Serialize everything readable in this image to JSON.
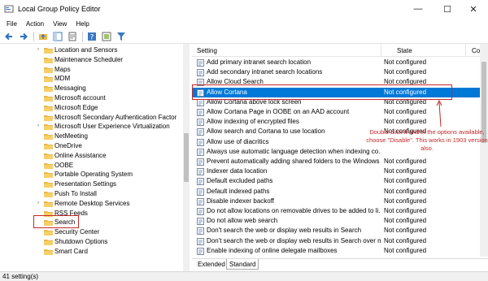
{
  "window": {
    "title": "Local Group Policy Editor",
    "minimize_glyph": "—",
    "maximize_glyph": "☐",
    "close_glyph": "✕"
  },
  "menu": [
    "File",
    "Action",
    "View",
    "Help"
  ],
  "toolbar_icons": [
    "back-arrow-icon",
    "forward-arrow-icon",
    "up-folder-icon",
    "show-hide-tree-icon",
    "export-list-icon",
    "help-icon",
    "properties-icon",
    "filter-icon"
  ],
  "tree": [
    {
      "label": "Location and Sensors",
      "expander": "›"
    },
    {
      "label": "Maintenance Scheduler",
      "expander": ""
    },
    {
      "label": "Maps",
      "expander": ""
    },
    {
      "label": "MDM",
      "expander": ""
    },
    {
      "label": "Messaging",
      "expander": ""
    },
    {
      "label": "Microsoft account",
      "expander": ""
    },
    {
      "label": "Microsoft Edge",
      "expander": ""
    },
    {
      "label": "Microsoft Secondary Authentication Factor",
      "expander": ""
    },
    {
      "label": "Microsoft User Experience Virtualization",
      "expander": "›"
    },
    {
      "label": "NetMeeting",
      "expander": ""
    },
    {
      "label": "OneDrive",
      "expander": ""
    },
    {
      "label": "Online Assistance",
      "expander": ""
    },
    {
      "label": "OOBE",
      "expander": ""
    },
    {
      "label": "Portable Operating System",
      "expander": ""
    },
    {
      "label": "Presentation Settings",
      "expander": ""
    },
    {
      "label": "Push To Install",
      "expander": ""
    },
    {
      "label": "Remote Desktop Services",
      "expander": "›"
    },
    {
      "label": "RSS Feeds",
      "expander": ""
    },
    {
      "label": "Search",
      "expander": ""
    },
    {
      "label": "Security Center",
      "expander": ""
    },
    {
      "label": "Shutdown Options",
      "expander": ""
    },
    {
      "label": "Smart Card",
      "expander": ""
    }
  ],
  "columns": {
    "setting": "Setting",
    "state": "State",
    "comment": "Co"
  },
  "settings": [
    {
      "name": "Add primary intranet search location",
      "state": "Not configured"
    },
    {
      "name": "Add secondary intranet search locations",
      "state": "Not configured"
    },
    {
      "name": "Allow Cloud Search",
      "state": "Not configured"
    },
    {
      "name": "Allow Cortana",
      "state": "Not configured"
    },
    {
      "name": "Allow Cortana above lock screen",
      "state": "Not configured"
    },
    {
      "name": "Allow Cortana Page in OOBE on an AAD account",
      "state": "Not configured"
    },
    {
      "name": "Allow indexing of encrypted files",
      "state": "Not configured"
    },
    {
      "name": "Allow search and Cortana to use location",
      "state": "Not configured"
    },
    {
      "name": "Allow use of diacritics",
      "state": ""
    },
    {
      "name": "Always use automatic language detection when indexing co...",
      "state": ""
    },
    {
      "name": "Prevent automatically adding shared folders to the Windows ...",
      "state": "Not configured"
    },
    {
      "name": "Indexer data location",
      "state": "Not configured"
    },
    {
      "name": "Default excluded paths",
      "state": "Not configured"
    },
    {
      "name": "Default indexed paths",
      "state": "Not configured"
    },
    {
      "name": "Disable indexer backoff",
      "state": "Not configured"
    },
    {
      "name": "Do not allow locations on removable drives to be added to li...",
      "state": "Not configured"
    },
    {
      "name": "Do not allow web search",
      "state": "Not configured"
    },
    {
      "name": "Don't search the web or display web results in Search",
      "state": "Not configured"
    },
    {
      "name": "Don't search the web or display web results in Search over m...",
      "state": "Not configured"
    },
    {
      "name": "Enable indexing of online delegate mailboxes",
      "state": "Not configured"
    }
  ],
  "tabs": {
    "extended": "Extended",
    "standard": "Standard"
  },
  "status": "41 setting(s)",
  "annotation": "Double click it and in the options available, choose \"Disable\". This works in 1903 version also.",
  "colors": {
    "selection": "#0078d7",
    "annotation": "#c62828",
    "folder": "#e8b84a"
  }
}
